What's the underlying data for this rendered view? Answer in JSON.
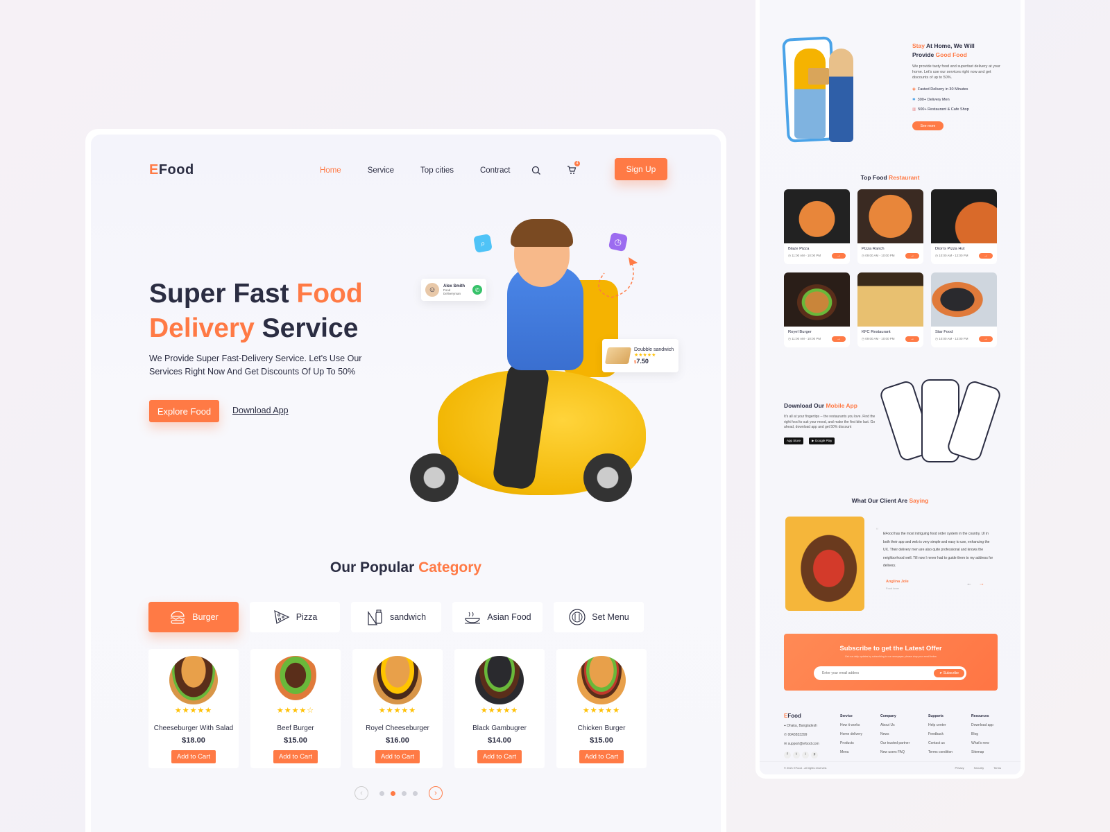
{
  "colors": {
    "accent": "#ff7a45",
    "text": "#2b2d42",
    "star": "#ffc107",
    "call_green": "#37c26a"
  },
  "header": {
    "logo_e": "E",
    "logo_rest": "Food",
    "nav": [
      {
        "label": "Home",
        "active": true
      },
      {
        "label": "Service"
      },
      {
        "label": "Top cities"
      },
      {
        "label": "Contract"
      }
    ],
    "cart_count": "4",
    "signup_label": "Sign Up",
    "icons": [
      "search-icon",
      "cart-icon"
    ]
  },
  "hero": {
    "title_part1": "Super Fast ",
    "title_highlight1": "Food",
    "title_highlight2": "Delivery",
    "title_part2": " Service",
    "description": "We Provide Super Fast-Delivery Service. Let's Use Our Services Right Now And Get Discounts Of Up To 50%",
    "explore_label": "Explore Food",
    "download_label": "Download App",
    "courier_card": {
      "name": "Alex Smith",
      "role": "Food Deliveryman"
    },
    "food_card": {
      "name": "Doubble sandwich",
      "currency": "$",
      "price": "7.50",
      "rating": 4.5
    }
  },
  "categories": {
    "title_part": "Our Popular ",
    "title_highlight": "Category",
    "items": [
      {
        "label": "Burger",
        "icon": "burger-icon",
        "active": true
      },
      {
        "label": "Pizza",
        "icon": "pizza-icon"
      },
      {
        "label": "sandwich",
        "icon": "sandwich-icon"
      },
      {
        "label": "Asian Food",
        "icon": "asian-food-icon"
      },
      {
        "label": "Set Menu",
        "icon": "set-menu-icon"
      }
    ]
  },
  "products": [
    {
      "name": "Cheeseburger With Salad",
      "price": "$18.00",
      "rating": 5,
      "stars": "★★★★★",
      "cta": "Add to Cart"
    },
    {
      "name": "Beef Burger",
      "price": "$15.00",
      "rating": 4.5,
      "stars": "★★★★☆",
      "cta": "Add to Cart"
    },
    {
      "name": "Royel Cheeseburger",
      "price": "$16.00",
      "rating": 5,
      "stars": "★★★★★",
      "cta": "Add to Cart"
    },
    {
      "name": "Black Gambugrer",
      "price": "$14.00",
      "rating": 5,
      "stars": "★★★★★",
      "cta": "Add to Cart"
    },
    {
      "name": "Chicken Burger",
      "price": "$15.00",
      "rating": 5,
      "stars": "★★★★★",
      "cta": "Add to Cart"
    }
  ],
  "pagination": {
    "pages": 4,
    "current": 2,
    "prev": "‹",
    "next": "›"
  },
  "side": {
    "about": {
      "title_hl1": "Stay",
      "title_mid": " At Home, We Will Provide ",
      "title_hl2": "Good Food",
      "desc": "We provide tasty food and superfast delivery at your home. Let's use our services right now and get discounts of up to 50%.",
      "features": [
        "Fasted Delivery in 30 Minutes",
        "300+ Delivery Men",
        "500+ Restaurant & Cafe Shop"
      ],
      "cta": "See more"
    },
    "restaurants": {
      "title_part": "Top Food ",
      "title_highlight": "Restaurant",
      "items": [
        {
          "name": "Blaze Pizza",
          "hours": "11:00 AM - 10:00 PM"
        },
        {
          "name": "Pizza Ranch",
          "hours": "09:00 AM - 10:00 PM"
        },
        {
          "name": "Dion's Pizza Hut",
          "hours": "10:00 AM - 12:00 PM"
        },
        {
          "name": "Royel Burger",
          "hours": "11:00 AM - 10:00 PM"
        },
        {
          "name": "KFC Restaurant",
          "hours": "09:00 AM - 10:00 PM"
        },
        {
          "name": "Star Food",
          "hours": "10:00 AM - 12:00 PM"
        }
      ],
      "go": "→"
    },
    "app": {
      "title_part": "Download  Our ",
      "title_highlight": "Mobile App",
      "desc": "It's all at your fingertips -- the restaurants you love. Find the right food to suit your mood, and make the first bite last. Go ahead, download app and get 50% discount",
      "app_store": "App Store",
      "google_play": "Google Play"
    },
    "testimonial": {
      "title_part": "What Our Client Are ",
      "title_highlight": "Saying",
      "quote": "EFood has the most intriguing food order system in the country. UI in both their app and web is very simple and easy to use, enhancing the UX. Their delivery men are also quite professional and knows the neighborhood well. Till now I never had to guide them to my address for delivery.",
      "author": "Anglina Jole",
      "author_role": "Food lover",
      "prev": "←",
      "next": "→"
    },
    "subscribe": {
      "title": "Subscribe to get the Latest Offer",
      "subtitle": "Get our daily updates by subscribing to our newspaper, please drop your email below",
      "placeholder": "Enter your email addres",
      "button": "Subscribe"
    },
    "footer": {
      "logo_e": "E",
      "logo_rest": "Food",
      "address": "Dhaka, Bangladesh",
      "phone": "0043833399",
      "email": "support@efood.com",
      "columns": [
        {
          "title": "Service",
          "links": [
            "How it works",
            "Home delivery",
            "Products",
            "Menu"
          ]
        },
        {
          "title": "Company",
          "links": [
            "About Us",
            "News",
            "Our trusted partner",
            "New users FAQ"
          ]
        },
        {
          "title": "Supports",
          "links": [
            "Help center",
            "Feedback",
            "Contact us",
            "Terms condition"
          ]
        },
        {
          "title": "Resources",
          "links": [
            "Download app",
            "Blog",
            "What's new",
            "Sitemap"
          ]
        }
      ],
      "copyright": "© 2021 EFood - All rights reserved.",
      "legal": [
        "Privacy",
        "Security",
        "Terms"
      ],
      "socials": [
        "f",
        "t",
        "i",
        "p"
      ]
    }
  }
}
